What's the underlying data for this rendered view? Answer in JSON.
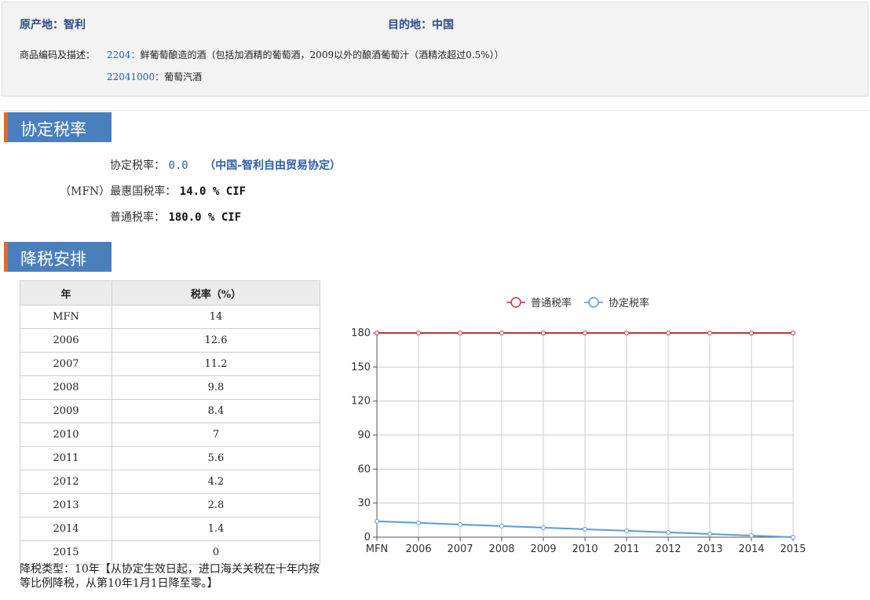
{
  "header": {
    "origin": "原产地：智利",
    "destination": "目的地：中国",
    "hs_label": "商品编码及描述：",
    "hs_lines": [
      {
        "code": "2204：",
        "desc": "鲜葡萄酿造的酒（包括加酒精的葡萄酒，2009以外的酿酒葡萄汁（酒精浓超过0.5%））"
      },
      {
        "code": "22041000：",
        "desc": "葡萄汽酒"
      }
    ]
  },
  "section1": {
    "title": "协定税率",
    "agreed_label": "协定税率：",
    "agreed_value": "0.0",
    "agreed_note": "（中国-智利自由贸易协定）",
    "mfn_label": "（MFN）最惠国税率：",
    "mfn_value": "14.0 % CIF",
    "general_label": "普通税率：",
    "general_value": "180.0 % CIF"
  },
  "section2": {
    "title": "降税安排",
    "table_headers": [
      "年",
      "税率（%）"
    ],
    "rows": [
      [
        "MFN",
        "14"
      ],
      [
        "2006",
        "12.6"
      ],
      [
        "2007",
        "11.2"
      ],
      [
        "2008",
        "9.8"
      ],
      [
        "2009",
        "8.4"
      ],
      [
        "2010",
        "7"
      ],
      [
        "2011",
        "5.6"
      ],
      [
        "2012",
        "4.2"
      ],
      [
        "2013",
        "2.8"
      ],
      [
        "2014",
        "1.4"
      ],
      [
        "2015",
        "0"
      ]
    ],
    "note": "降税类型：10年【从协定生效日起，进口海关关税在十年内按等比例降税，从第10年1月1日降至零。】"
  },
  "chart_data": {
    "type": "line",
    "categories": [
      "MFN",
      "2006",
      "2007",
      "2008",
      "2009",
      "2010",
      "2011",
      "2012",
      "2013",
      "2014",
      "2015"
    ],
    "series": [
      {
        "name": "普通税率",
        "color": "#c23531",
        "values": [
          180,
          180,
          180,
          180,
          180,
          180,
          180,
          180,
          180,
          180,
          180
        ]
      },
      {
        "name": "协定税率",
        "color": "#5b9bd5",
        "values": [
          14,
          12.6,
          11.2,
          9.8,
          8.4,
          7,
          5.6,
          4.2,
          2.8,
          1.4,
          0
        ]
      }
    ],
    "yticks": [
      0,
      30,
      60,
      90,
      120,
      150,
      180
    ],
    "ylim": [
      0,
      180
    ],
    "grid": true,
    "legend": "top-center"
  }
}
